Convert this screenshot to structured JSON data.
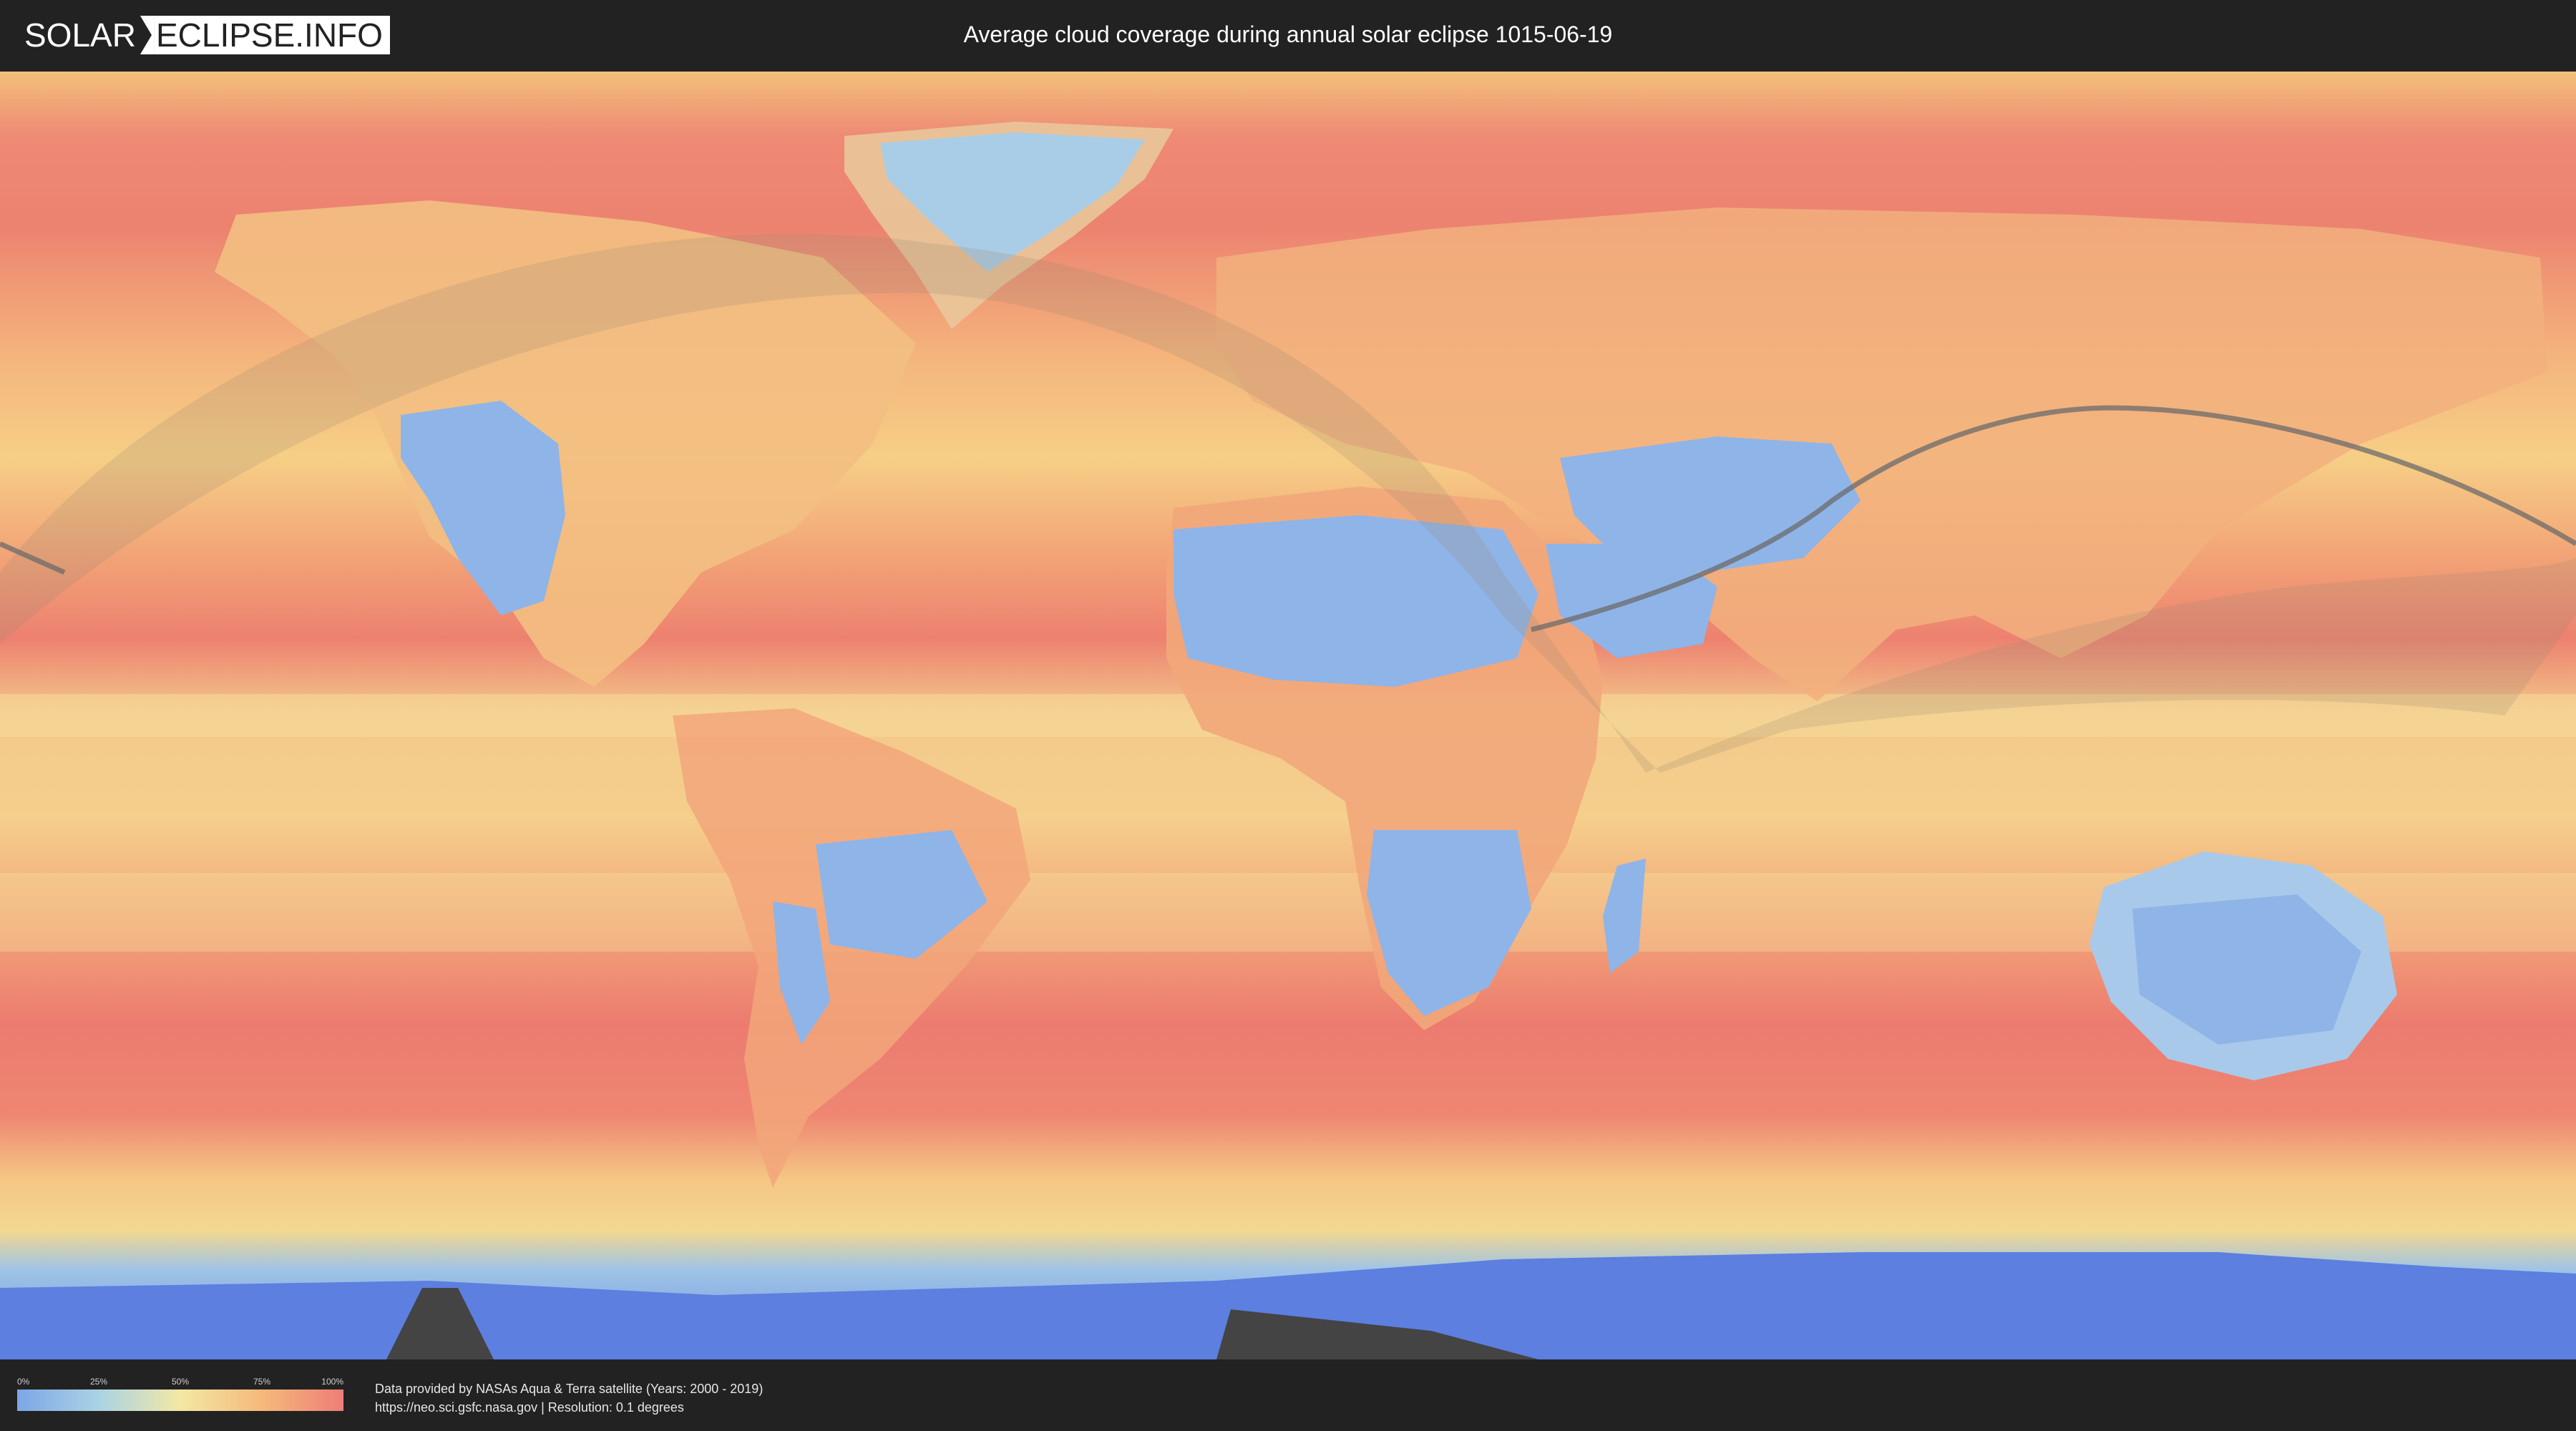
{
  "header": {
    "logo_left": "SOLAR",
    "logo_right": "ECLIPSE.INFO",
    "title": "Average cloud coverage during annual solar eclipse 1015-06-19"
  },
  "legend": {
    "ticks": [
      "0%",
      "25%",
      "50%",
      "75%",
      "100%"
    ],
    "colors": [
      "#7da6e6",
      "#a9d3e4",
      "#f3e8a4",
      "#f5b97a",
      "#ef7d78"
    ]
  },
  "footer": {
    "source_line": "Data provided by NASAs Aqua & Terra satellite (Years: 2000 - 2019)",
    "url_line": "https://neo.sci.gsfc.nasa.gov | Resolution: 0.1 degrees"
  },
  "map": {
    "projection": "equirectangular",
    "colors": {
      "cloudy": "#ef7d78",
      "medium": "#f5b97a",
      "moderate": "#f3e8a4",
      "clear": "#8fb4e8",
      "antarctic_ice": "#5c7fe0",
      "eclipse_path": "#6b6b6b",
      "penumbra_shade": "#9a8a70"
    }
  }
}
